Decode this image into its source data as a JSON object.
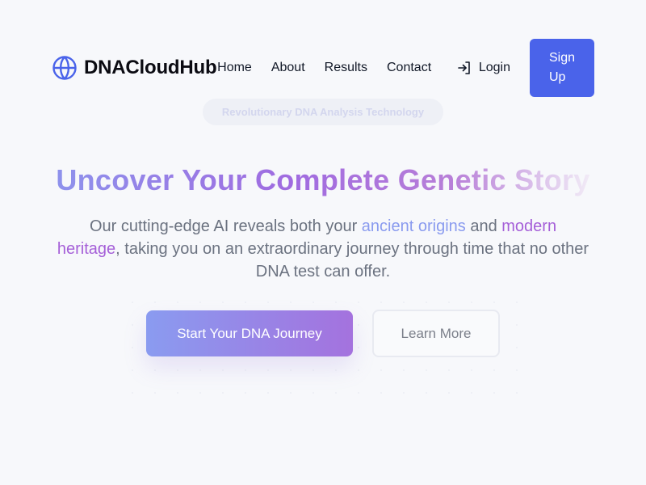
{
  "brand": {
    "name": "DNACloudHub",
    "icon": "globe-icon",
    "accent": "#4a63ea"
  },
  "nav": {
    "items": [
      {
        "label": "Home"
      },
      {
        "label": "About"
      },
      {
        "label": "Results"
      },
      {
        "label": "Contact"
      }
    ]
  },
  "auth": {
    "login_label": "Login",
    "login_icon": "login-icon",
    "signup_label": "Sign Up"
  },
  "hero": {
    "pill": "Revolutionary DNA Analysis Technology",
    "title": "Uncover Your Complete Genetic Story",
    "subtitle_part1": "Our cutting-edge AI reveals both your ",
    "highlight_1": "ancient origins",
    "subtitle_part2": " and ",
    "highlight_2": "modern heritage",
    "subtitle_part3": ", taking you on an extraordinary journey through time that no other DNA test can offer.",
    "primary_cta": "Start Your DNA Journey",
    "secondary_cta": "Learn More"
  },
  "colors": {
    "background": "#f7f8fb",
    "primary_button_start": "#8a9bf0",
    "primary_button_end": "#a472de",
    "highlight_blue": "#8a9bef",
    "highlight_purple": "#a55fd8"
  }
}
